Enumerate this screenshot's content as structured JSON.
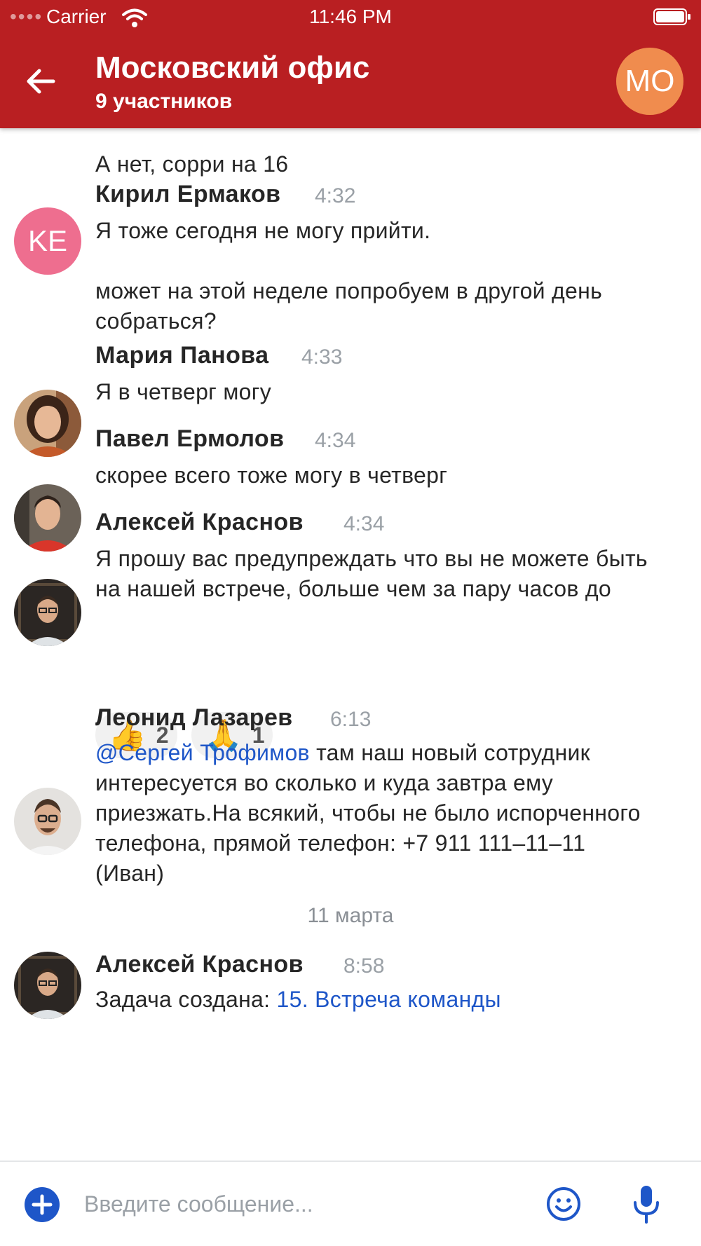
{
  "status_bar": {
    "carrier": "Carrier",
    "time": "11:46 PM"
  },
  "header": {
    "title": "Московский офис",
    "subtitle": "9 участников",
    "avatar_initials": "MO",
    "avatar_color": "#f08c4e",
    "accent_color": "#b91f22"
  },
  "messages": [
    {
      "text": "А нет, сорри на 16"
    },
    {
      "author": "Кирил Ермаков",
      "time": "4:32",
      "avatar_initials": "KE",
      "text": "Я тоже сегодня не могу прийти.\n\nможет на этой неделе попробуем в другой день собраться?"
    },
    {
      "author": "Мария Панова",
      "time": "4:33",
      "text": "Я в четверг могу"
    },
    {
      "author": "Павел Ермолов",
      "time": "4:34",
      "text": "скорее всего тоже могу в четверг"
    },
    {
      "author": "Алексей Краснов",
      "time": "4:34",
      "text": "Я прошу вас предупреждать что вы не можете быть на нашей встрече, больше чем за пару часов до",
      "reactions": [
        {
          "emoji": "👍",
          "count": "2"
        },
        {
          "emoji": "🙏",
          "count": "1"
        }
      ]
    },
    {
      "author": "Леонид Лазарев",
      "time": "6:13",
      "mention": "@Сергей Трофимов",
      "text": " там наш новый сотрудник интересуется во сколько и куда завтра ему приезжать.На всякий, чтобы не было испорченного телефона, прямой телефон: +7 911 111–11–11  (Иван)"
    },
    {
      "author": "Алексей Краснов",
      "time": "8:58",
      "text": "Задача создана: ",
      "link": "15. Встреча команды"
    }
  ],
  "date_separator": "11 марта",
  "composer": {
    "placeholder": "Введите сообщение..."
  }
}
